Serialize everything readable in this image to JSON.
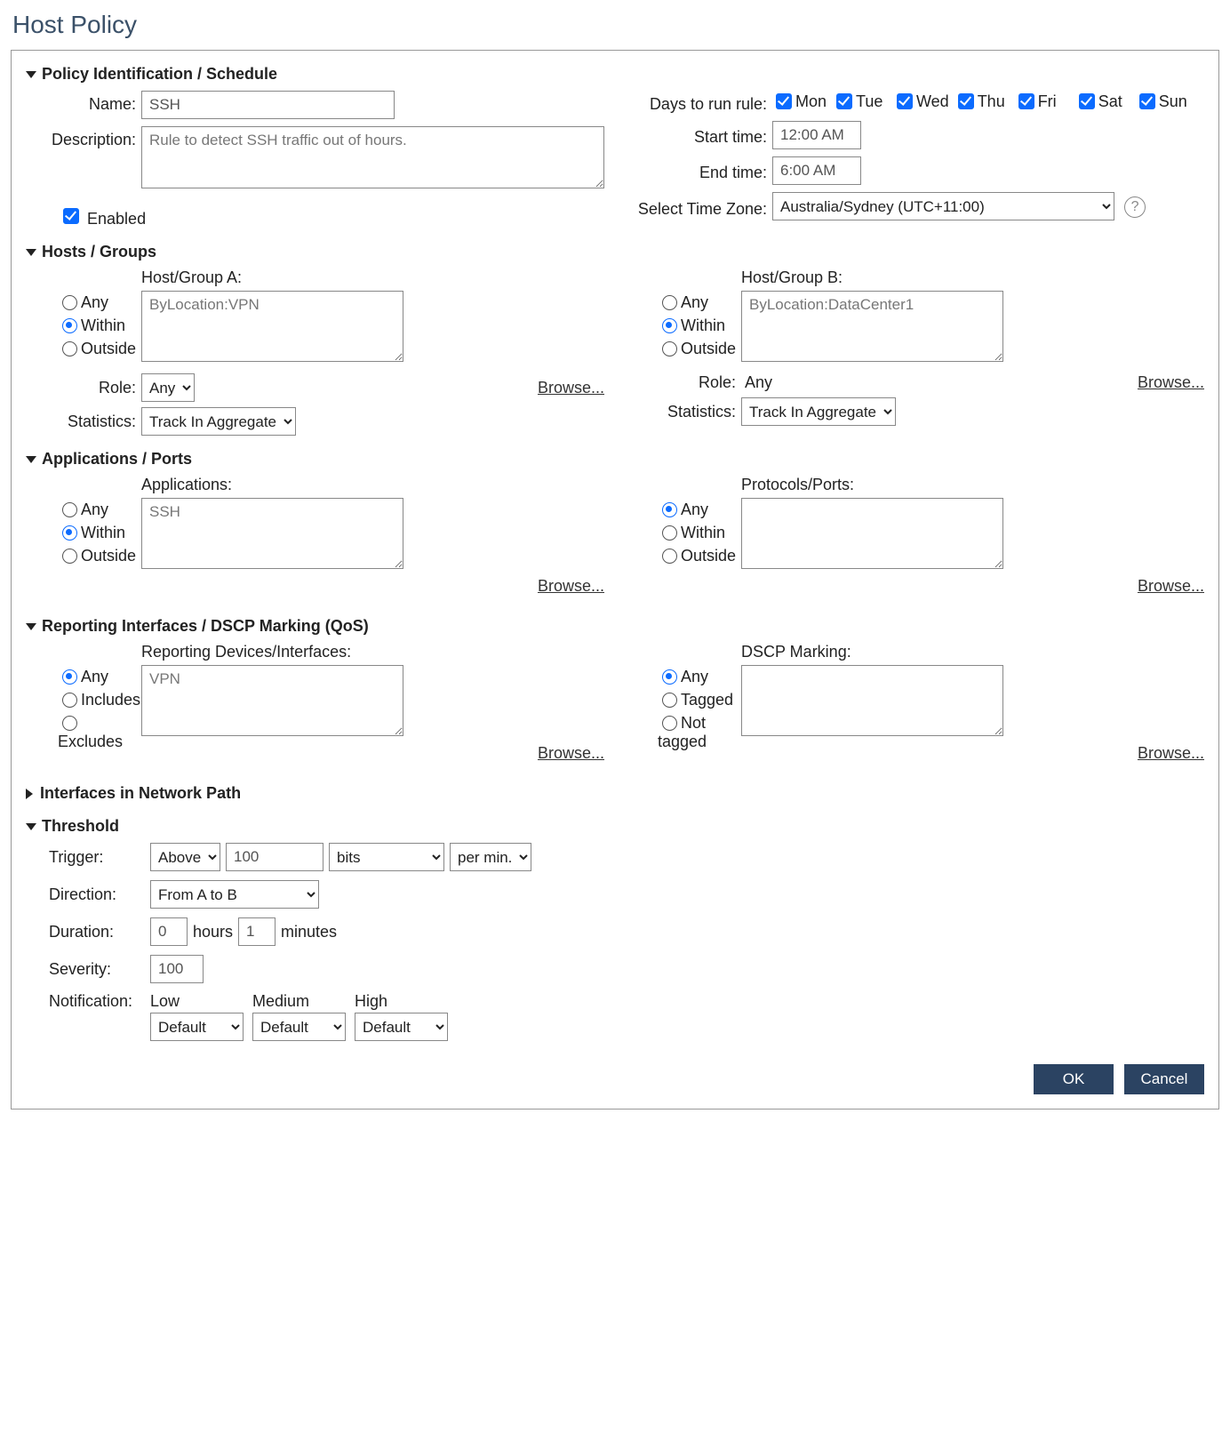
{
  "page_title": "Host Policy",
  "sections": {
    "policy_id": {
      "title": "Policy Identification / Schedule",
      "name_label": "Name:",
      "name_value": "SSH",
      "desc_label": "Description:",
      "desc_value": "Rule to detect SSH traffic out of hours.",
      "enabled_label": "Enabled",
      "enabled_checked": true,
      "days_label": "Days to run rule:",
      "days": [
        {
          "label": "Mon",
          "checked": true
        },
        {
          "label": "Tue",
          "checked": true
        },
        {
          "label": "Wed",
          "checked": true
        },
        {
          "label": "Thu",
          "checked": true
        },
        {
          "label": "Fri",
          "checked": true
        },
        {
          "label": "Sat",
          "checked": true
        },
        {
          "label": "Sun",
          "checked": true
        }
      ],
      "start_label": "Start time:",
      "start_value": "12:00 AM",
      "end_label": "End time:",
      "end_value": "6:00 AM",
      "tz_label": "Select Time Zone:",
      "tz_value": "Australia/Sydney (UTC+11:00)"
    },
    "hosts": {
      "title": "Hosts / Groups",
      "group_a": {
        "label": "Host/Group A:",
        "value": "ByLocation:VPN",
        "radios": {
          "any": "Any",
          "within": "Within",
          "outside": "Outside",
          "selected": "within"
        },
        "role_label": "Role:",
        "role_value": "Any",
        "stats_label": "Statistics:",
        "stats_value": "Track In Aggregate",
        "browse": "Browse..."
      },
      "group_b": {
        "label": "Host/Group B:",
        "value": "ByLocation:DataCenter1",
        "radios": {
          "any": "Any",
          "within": "Within",
          "outside": "Outside",
          "selected": "within"
        },
        "role_label": "Role:",
        "role_value": "Any",
        "stats_label": "Statistics:",
        "stats_value": "Track In Aggregate",
        "browse": "Browse..."
      }
    },
    "apps": {
      "title": "Applications / Ports",
      "applications": {
        "label": "Applications:",
        "value": "SSH",
        "radios": {
          "any": "Any",
          "within": "Within",
          "outside": "Outside",
          "selected": "within"
        },
        "browse": "Browse..."
      },
      "protocols": {
        "label": "Protocols/Ports:",
        "value": "",
        "radios": {
          "any": "Any",
          "within": "Within",
          "outside": "Outside",
          "selected": "any"
        },
        "browse": "Browse..."
      }
    },
    "reporting": {
      "title": "Reporting Interfaces / DSCP Marking (QoS)",
      "devices": {
        "label": "Reporting Devices/Interfaces:",
        "value": "VPN",
        "radios": {
          "any": "Any",
          "includes": "Includes",
          "excludes": "Excludes",
          "selected": "any"
        },
        "browse": "Browse..."
      },
      "dscp": {
        "label": "DSCP Marking:",
        "value": "",
        "radios": {
          "any": "Any",
          "tagged": "Tagged",
          "not_tagged": "Not tagged",
          "selected": "any"
        },
        "browse": "Browse..."
      }
    },
    "interfaces_path": {
      "title": "Interfaces in Network Path"
    },
    "threshold": {
      "title": "Threshold",
      "trigger_label": "Trigger:",
      "trigger_compare": "Above",
      "trigger_value": "100",
      "trigger_unit": "bits",
      "trigger_per": "per min.",
      "direction_label": "Direction:",
      "direction_value": "From A to B",
      "duration_label": "Duration:",
      "duration_hours": "0",
      "duration_hours_suffix": "hours",
      "duration_minutes": "1",
      "duration_minutes_suffix": "minutes",
      "severity_label": "Severity:",
      "severity_value": "100",
      "notification_label": "Notification:",
      "notif_cols": {
        "low": {
          "label": "Low",
          "value": "Default"
        },
        "medium": {
          "label": "Medium",
          "value": "Default"
        },
        "high": {
          "label": "High",
          "value": "Default"
        }
      }
    }
  },
  "buttons": {
    "ok": "OK",
    "cancel": "Cancel"
  }
}
